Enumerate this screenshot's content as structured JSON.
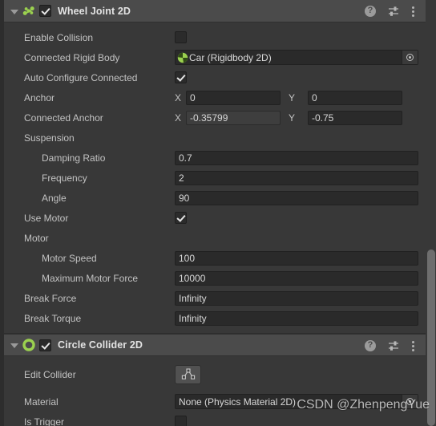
{
  "components": [
    {
      "title": "Wheel Joint 2D",
      "icon": "wheel-joint-2d-icon",
      "enabled_checkbox": true,
      "expanded": true,
      "header_icons": {
        "help": "help-icon",
        "preset": "preset-icon",
        "menu": "kebab-menu-icon"
      },
      "rows": [
        {
          "label": "Enable Collision",
          "type": "checkbox",
          "value": false
        },
        {
          "label": "Connected Rigid Body",
          "type": "object",
          "value": "Car (Rigidbody 2D)",
          "object_icon": "rigidbody-2d-icon"
        },
        {
          "label": "Auto Configure Connected",
          "type": "checkbox",
          "value": true
        },
        {
          "label": "Anchor",
          "type": "vector2",
          "x_label": "X",
          "y_label": "Y",
          "x": "0",
          "y": "0"
        },
        {
          "label": "Connected Anchor",
          "type": "vector2",
          "x_label": "X",
          "y_label": "Y",
          "x": "-0.35799",
          "y": "-0.75"
        },
        {
          "label": "Suspension",
          "type": "foldout"
        },
        {
          "label": "Damping Ratio",
          "type": "text",
          "value": "0.7",
          "indent": 1
        },
        {
          "label": "Frequency",
          "type": "text",
          "value": "2",
          "indent": 1
        },
        {
          "label": "Angle",
          "type": "text",
          "value": "90",
          "indent": 1
        },
        {
          "label": "Use Motor",
          "type": "checkbox",
          "value": true
        },
        {
          "label": "Motor",
          "type": "foldout"
        },
        {
          "label": "Motor Speed",
          "type": "text",
          "value": "100",
          "indent": 1
        },
        {
          "label": "Maximum Motor Force",
          "type": "text",
          "value": "10000",
          "indent": 1
        },
        {
          "label": "Break Force",
          "type": "text",
          "value": "Infinity"
        },
        {
          "label": "Break Torque",
          "type": "text",
          "value": "Infinity"
        }
      ]
    },
    {
      "title": "Circle Collider 2D",
      "icon": "circle-collider-2d-icon",
      "enabled_checkbox": true,
      "expanded": true,
      "header_icons": {
        "help": "help-icon",
        "preset": "preset-icon",
        "menu": "kebab-menu-icon"
      },
      "rows": [
        {
          "label": "Edit Collider",
          "type": "button",
          "button_icon": "edit-collider-icon"
        },
        {
          "label": "Material",
          "type": "object",
          "value": "None (Physics Material 2D)",
          "object_icon": null
        },
        {
          "label": "Is Trigger",
          "type": "checkbox",
          "value": false
        }
      ]
    }
  ],
  "watermark": "CSDN @ZhenpengYue",
  "colors": {
    "panel_bg": "#383838",
    "header_bg": "#4b4b4b",
    "field_bg": "#2a2a2a",
    "accent_green": "#9bd14f",
    "text": "#c2c2c2",
    "scrollbar_thumb": "#6e6e6e"
  },
  "scrollbar": {
    "present": true
  }
}
